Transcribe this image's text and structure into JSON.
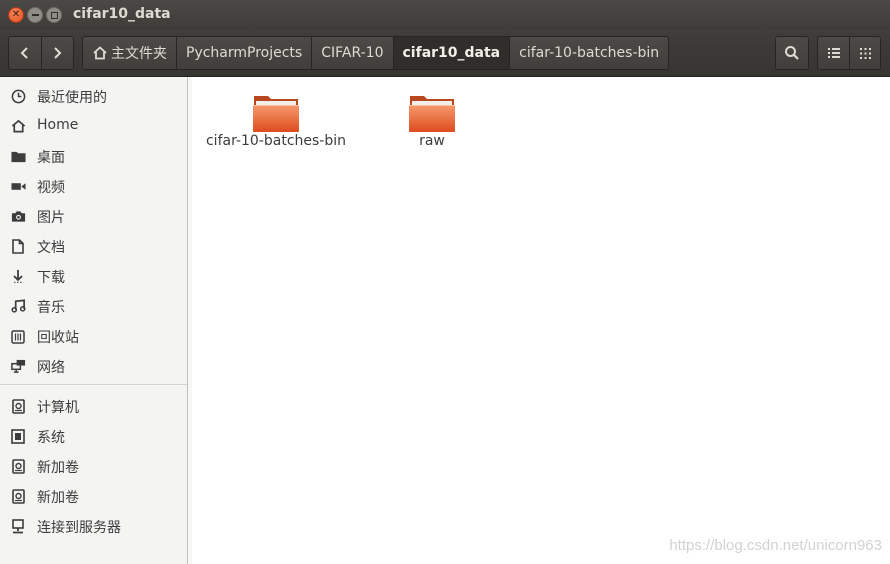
{
  "window": {
    "title": "cifar10_data"
  },
  "toolbar": {
    "back_icon": "chevron-left-icon",
    "forward_icon": "chevron-right-icon",
    "breadcrumbs": [
      {
        "label": "主文件夹",
        "icon": "home-icon"
      },
      {
        "label": "PycharmProjects"
      },
      {
        "label": "CIFAR-10"
      },
      {
        "label": "cifar10_data",
        "active": true
      },
      {
        "label": "cifar-10-batches-bin"
      }
    ],
    "search_icon": "search-icon",
    "list_view_icon": "list-view-icon",
    "grid_view_icon": "grid-view-icon"
  },
  "sidebar": {
    "places": [
      {
        "label": "最近使用的",
        "icon": "clock-icon"
      },
      {
        "label": "Home",
        "icon": "home-icon"
      },
      {
        "label": "桌面",
        "icon": "folder-icon"
      },
      {
        "label": "视频",
        "icon": "video-icon"
      },
      {
        "label": "图片",
        "icon": "camera-icon"
      },
      {
        "label": "文档",
        "icon": "document-icon"
      },
      {
        "label": "下载",
        "icon": "download-icon"
      },
      {
        "label": "音乐",
        "icon": "music-icon"
      },
      {
        "label": "回收站",
        "icon": "trash-icon"
      },
      {
        "label": "网络",
        "icon": "network-icon"
      }
    ],
    "devices": [
      {
        "label": "计算机",
        "icon": "drive-icon"
      },
      {
        "label": "系统",
        "icon": "chip-icon"
      },
      {
        "label": "新加卷",
        "icon": "drive-icon"
      },
      {
        "label": "新加卷",
        "icon": "drive-icon"
      },
      {
        "label": "连接到服务器",
        "icon": "server-icon"
      }
    ]
  },
  "files": [
    {
      "name": "cifar-10-batches-bin",
      "type": "folder"
    },
    {
      "name": "raw",
      "type": "folder"
    }
  ],
  "colors": {
    "folder": "#e4572e",
    "titlebar": "#3d3c38",
    "sidebar": "#f4f4f3"
  },
  "watermark": "https://blog.csdn.net/unicorn963"
}
